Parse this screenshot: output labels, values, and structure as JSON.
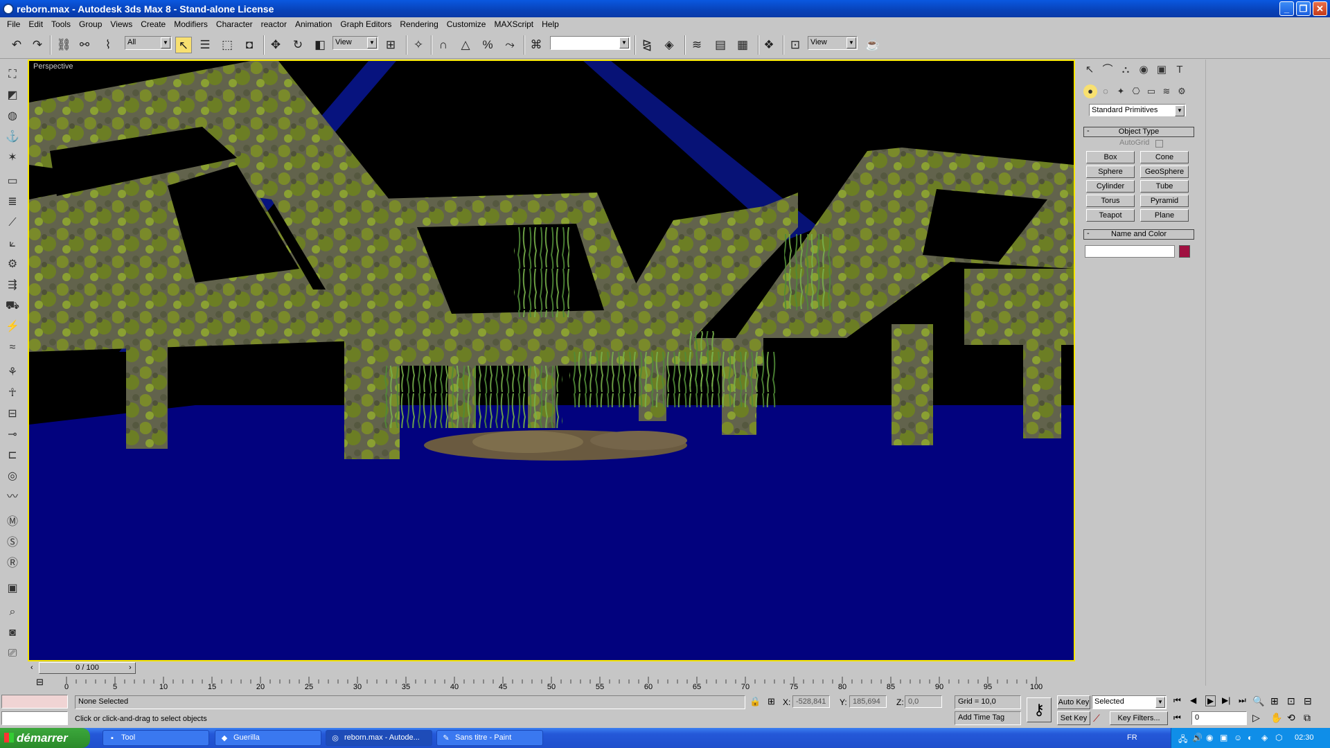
{
  "window": {
    "title": "reborn.max - Autodesk 3ds Max 8 - Stand-alone License",
    "minimize": "_",
    "maximize": "❐",
    "close": "✕"
  },
  "menu": [
    "File",
    "Edit",
    "Tools",
    "Group",
    "Views",
    "Create",
    "Modifiers",
    "Character",
    "reactor",
    "Animation",
    "Graph Editors",
    "Rendering",
    "Customize",
    "MAXScript",
    "Help"
  ],
  "toolbar": {
    "selection_filter": "All",
    "reference_coord": "View",
    "named_selection": "",
    "render_type": "View"
  },
  "viewport": {
    "label": "Perspective",
    "background": "#000000",
    "ground_color": "#02027e"
  },
  "command_panel": {
    "category": "Standard Primitives",
    "object_type_title": "Object Type",
    "autogrid": "AutoGrid",
    "primitives": [
      "Box",
      "Cone",
      "Sphere",
      "GeoSphere",
      "Cylinder",
      "Tube",
      "Torus",
      "Pyramid",
      "Teapot",
      "Plane"
    ],
    "name_color_title": "Name and Color",
    "name_value": "",
    "object_color": "#a01040"
  },
  "timeline": {
    "frame_display": "0 / 100",
    "ticks": [
      "0",
      "5",
      "10",
      "15",
      "20",
      "25",
      "30",
      "35",
      "40",
      "45",
      "50",
      "55",
      "60",
      "65",
      "70",
      "75",
      "80",
      "85",
      "90",
      "95",
      "100"
    ]
  },
  "status": {
    "selection": "None Selected",
    "prompt": "Click or click-and-drag to select objects",
    "x_label": "X:",
    "x_value": "-528,841",
    "y_label": "Y:",
    "y_value": "185,694",
    "z_label": "Z:",
    "z_value": "0,0",
    "grid": "Grid = 10,0",
    "add_time_tag": "Add Time Tag",
    "auto_key": "Auto Key",
    "set_key": "Set Key",
    "key_mode": "Selected",
    "key_filters": "Key Filters...",
    "current_frame": "0"
  },
  "taskbar": {
    "start": "démarrer",
    "tasks": [
      "Tool",
      "Guerilla",
      "reborn.max - Autode...",
      "Sans titre - Paint"
    ],
    "language": "FR",
    "clock": "02:30"
  }
}
